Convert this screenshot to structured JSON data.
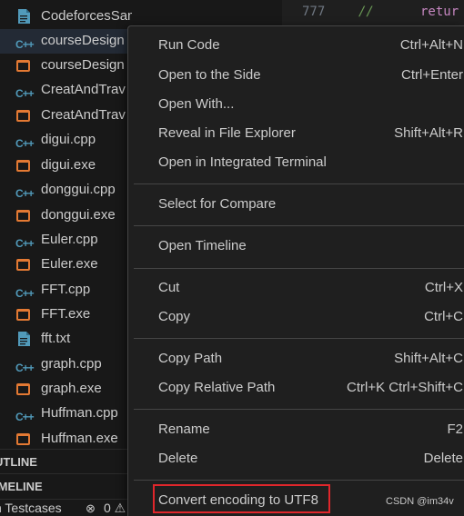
{
  "explorer": {
    "files": [
      {
        "name": "CodeforcesSample.txt",
        "icon": "txt-file-icon"
      },
      {
        "name": "courseDesign",
        "icon": "cpp-file-icon"
      },
      {
        "name": "courseDesign",
        "icon": "exe-file-icon"
      },
      {
        "name": "CreatAndTrav",
        "icon": "cpp-file-icon"
      },
      {
        "name": "CreatAndTrav",
        "icon": "exe-file-icon"
      },
      {
        "name": "digui.cpp",
        "icon": "cpp-file-icon"
      },
      {
        "name": "digui.exe",
        "icon": "exe-file-icon"
      },
      {
        "name": "donggui.cpp",
        "icon": "cpp-file-icon"
      },
      {
        "name": "donggui.exe",
        "icon": "exe-file-icon"
      },
      {
        "name": "Euler.cpp",
        "icon": "cpp-file-icon"
      },
      {
        "name": "Euler.exe",
        "icon": "exe-file-icon"
      },
      {
        "name": "FFT.cpp",
        "icon": "cpp-file-icon"
      },
      {
        "name": "FFT.exe",
        "icon": "exe-file-icon"
      },
      {
        "name": "fft.txt",
        "icon": "txt-file-icon"
      },
      {
        "name": "graph.cpp",
        "icon": "cpp-file-icon"
      },
      {
        "name": "graph.exe",
        "icon": "exe-file-icon"
      },
      {
        "name": "Huffman.cpp",
        "icon": "cpp-file-icon"
      },
      {
        "name": "Huffman.exe",
        "icon": "exe-file-icon"
      }
    ],
    "cpp_icon_text": "C++",
    "outline_label": "UTLINE",
    "timeline_label": "IMELINE"
  },
  "statusbar": {
    "testcases_label": "n Testcases",
    "error_icon": "⊗",
    "error_count": "0 ⚠"
  },
  "editor": {
    "line_number": "777",
    "comment": "//",
    "code": "retur"
  },
  "context_menu": {
    "run_code": {
      "label": "Run Code",
      "shortcut": "Ctrl+Alt+N"
    },
    "open_side": {
      "label": "Open to the Side",
      "shortcut": "Ctrl+Enter"
    },
    "open_with": {
      "label": "Open With..."
    },
    "reveal": {
      "label": "Reveal in File Explorer",
      "shortcut": "Shift+Alt+R"
    },
    "open_terminal": {
      "label": "Open in Integrated Terminal"
    },
    "select_compare": {
      "label": "Select for Compare"
    },
    "open_timeline": {
      "label": "Open Timeline"
    },
    "cut": {
      "label": "Cut",
      "shortcut": "Ctrl+X"
    },
    "copy": {
      "label": "Copy",
      "shortcut": "Ctrl+C"
    },
    "copy_path": {
      "label": "Copy Path",
      "shortcut": "Shift+Alt+C"
    },
    "copy_relative_path": {
      "label": "Copy Relative Path",
      "shortcut": "Ctrl+K Ctrl+Shift+C"
    },
    "rename": {
      "label": "Rename",
      "shortcut": "F2"
    },
    "delete": {
      "label": "Delete",
      "shortcut": "Delete"
    },
    "convert_encoding": {
      "label": "Convert encoding to UTF8"
    }
  },
  "watermark": "CSDN @im34v",
  "colors": {
    "background": "#181818",
    "menu_background": "#1f1f1f",
    "highlight_border": "#e0262b",
    "cpp_icon": "#519aba",
    "exe_icon": "#e37933",
    "txt_icon": "#519aba"
  }
}
